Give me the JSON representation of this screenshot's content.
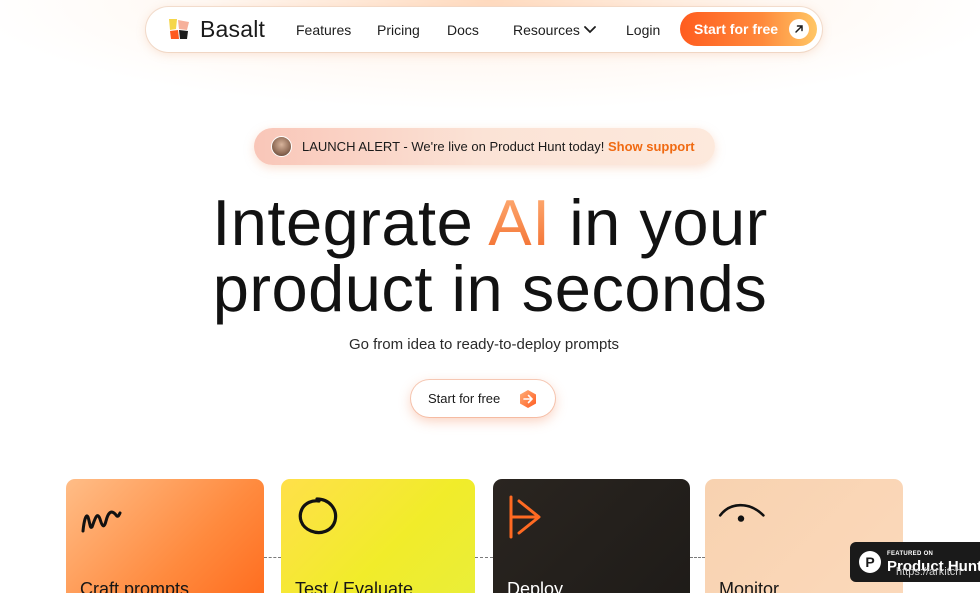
{
  "nav": {
    "brand": "Basalt",
    "links": [
      "Features",
      "Pricing",
      "Docs",
      "Resources",
      "Login"
    ],
    "cta": "Start for free"
  },
  "launch": {
    "prefix": "LAUNCH ALERT - We're live on Product Hunt today!",
    "link": "Show support"
  },
  "hero": {
    "title_part1": "Integrate ",
    "title_accent": "AI",
    "title_part2": " in your",
    "title_line2": "product in seconds",
    "subtitle": "Go from idea to ready-to-deploy prompts",
    "cta": "Start for free"
  },
  "cards": [
    {
      "title": "Craft prompts",
      "icon": "squiggle-icon"
    },
    {
      "title": "Test / Evaluate",
      "icon": "circle-icon"
    },
    {
      "title": "Deploy",
      "icon": "deploy-icon"
    },
    {
      "title": "Monitor",
      "icon": "eye-icon"
    }
  ],
  "product_hunt": {
    "small": "FEATURED ON",
    "big": "Product Hunt",
    "letter": "P"
  },
  "watermark": "https://arkitch",
  "colors": {
    "accent": "#ff6a1c",
    "card_orange": "#ff8a3e",
    "card_yellow": "#f1ec2a",
    "card_dark": "#1e1b18",
    "card_peach": "#f9d4b3"
  }
}
